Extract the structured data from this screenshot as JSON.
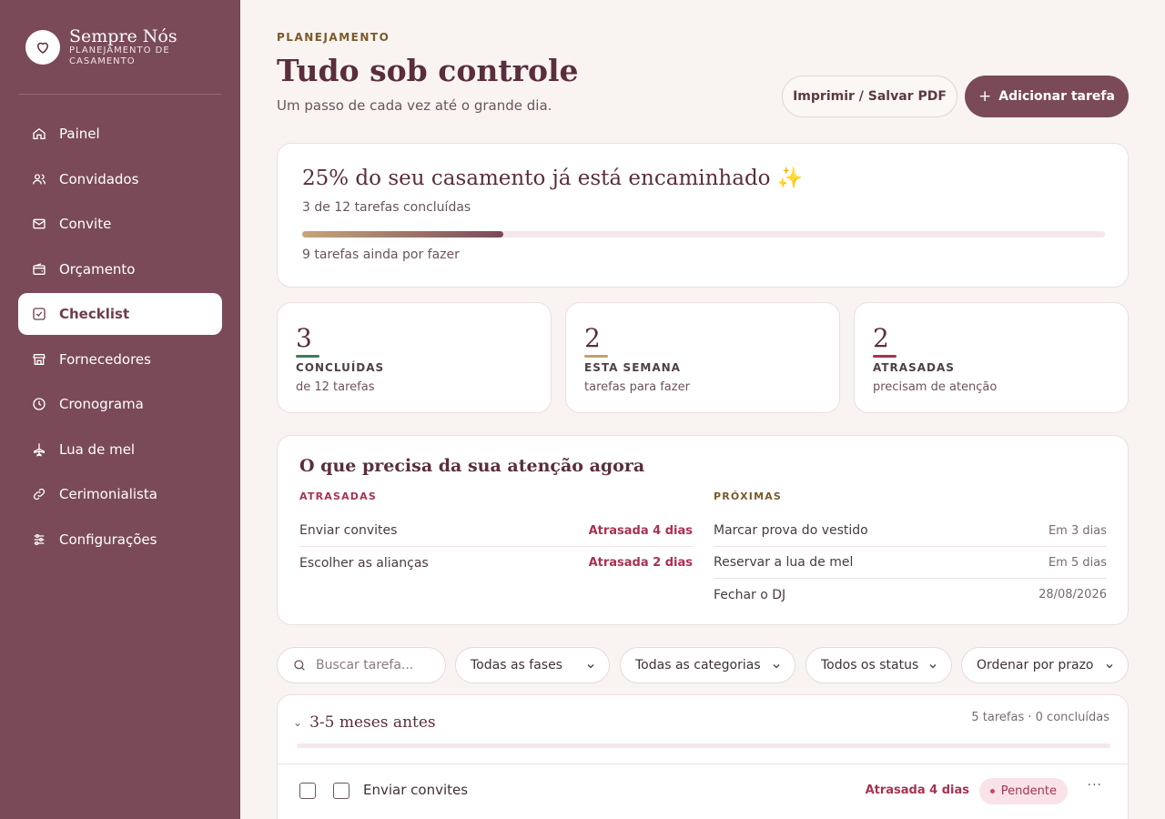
{
  "brand": {
    "name": "Sempre Nós",
    "subtitle": "PLANEJAMENTO DE CASAMENTO"
  },
  "sidebar": {
    "items": [
      {
        "label": "Painel",
        "icon": "home-icon",
        "active": false
      },
      {
        "label": "Convidados",
        "icon": "users-icon",
        "active": false
      },
      {
        "label": "Convite",
        "icon": "mail-icon",
        "active": false
      },
      {
        "label": "Orçamento",
        "icon": "wallet-icon",
        "active": false
      },
      {
        "label": "Checklist",
        "icon": "checkbox-icon",
        "active": true
      },
      {
        "label": "Fornecedores",
        "icon": "store-icon",
        "active": false
      },
      {
        "label": "Cronograma",
        "icon": "clock-icon",
        "active": false
      },
      {
        "label": "Lua de mel",
        "icon": "plane-icon",
        "active": false
      },
      {
        "label": "Cerimonialista",
        "icon": "link-icon",
        "active": false
      },
      {
        "label": "Configurações",
        "icon": "sliders-icon",
        "active": false
      }
    ]
  },
  "header": {
    "eyebrow": "PLANEJAMENTO",
    "title": "Tudo sob controle",
    "subtitle": "Um passo de cada vez até o grande dia.",
    "print_label": "Imprimir / Salvar PDF",
    "add_label": "Adicionar tarefa"
  },
  "progress": {
    "title": "25% do seu casamento já está encaminhado ✨",
    "subtitle": "3 de 12 tarefas concluídas",
    "fraction": 0.25,
    "footer": "9 tarefas ainda por fazer"
  },
  "stats": [
    {
      "value": "3",
      "label": "CONCLUÍDAS",
      "caption": "de 12 tarefas",
      "color": "#3f7a5a"
    },
    {
      "value": "2",
      "label": "ESTA SEMANA",
      "caption": "tarefas para fazer",
      "color": "#c2a06a"
    },
    {
      "value": "2",
      "label": "ATRASADAS",
      "caption": "precisam de atenção",
      "color": "#a8324f"
    }
  ],
  "attention": {
    "title": "O que precisa da sua atenção agora",
    "late_heading": "ATRASADAS",
    "late": [
      {
        "task": "Enviar convites",
        "status": "Atrasada 4 dias"
      },
      {
        "task": "Escolher as alianças",
        "status": "Atrasada 2 dias"
      }
    ],
    "next_heading": "PRÓXIMAS",
    "next": [
      {
        "task": "Marcar prova do vestido",
        "when": "Em 3 dias"
      },
      {
        "task": "Reservar a lua de mel",
        "when": "Em 5 dias"
      },
      {
        "task": "Fechar o DJ",
        "when": "28/08/2026"
      }
    ]
  },
  "filters": {
    "search_placeholder": "Buscar tarefa...",
    "phase": "Todas as fases",
    "category": "Todas as categorias",
    "status": "Todos os status",
    "sort": "Ordenar por prazo"
  },
  "group": {
    "title": "3-5 meses antes",
    "count": "5 tarefas · 0 concluídas",
    "tasks": [
      {
        "name": "Enviar convites",
        "late": "Atrasada 4 dias",
        "badge": "Pendente",
        "more": "···"
      }
    ]
  }
}
